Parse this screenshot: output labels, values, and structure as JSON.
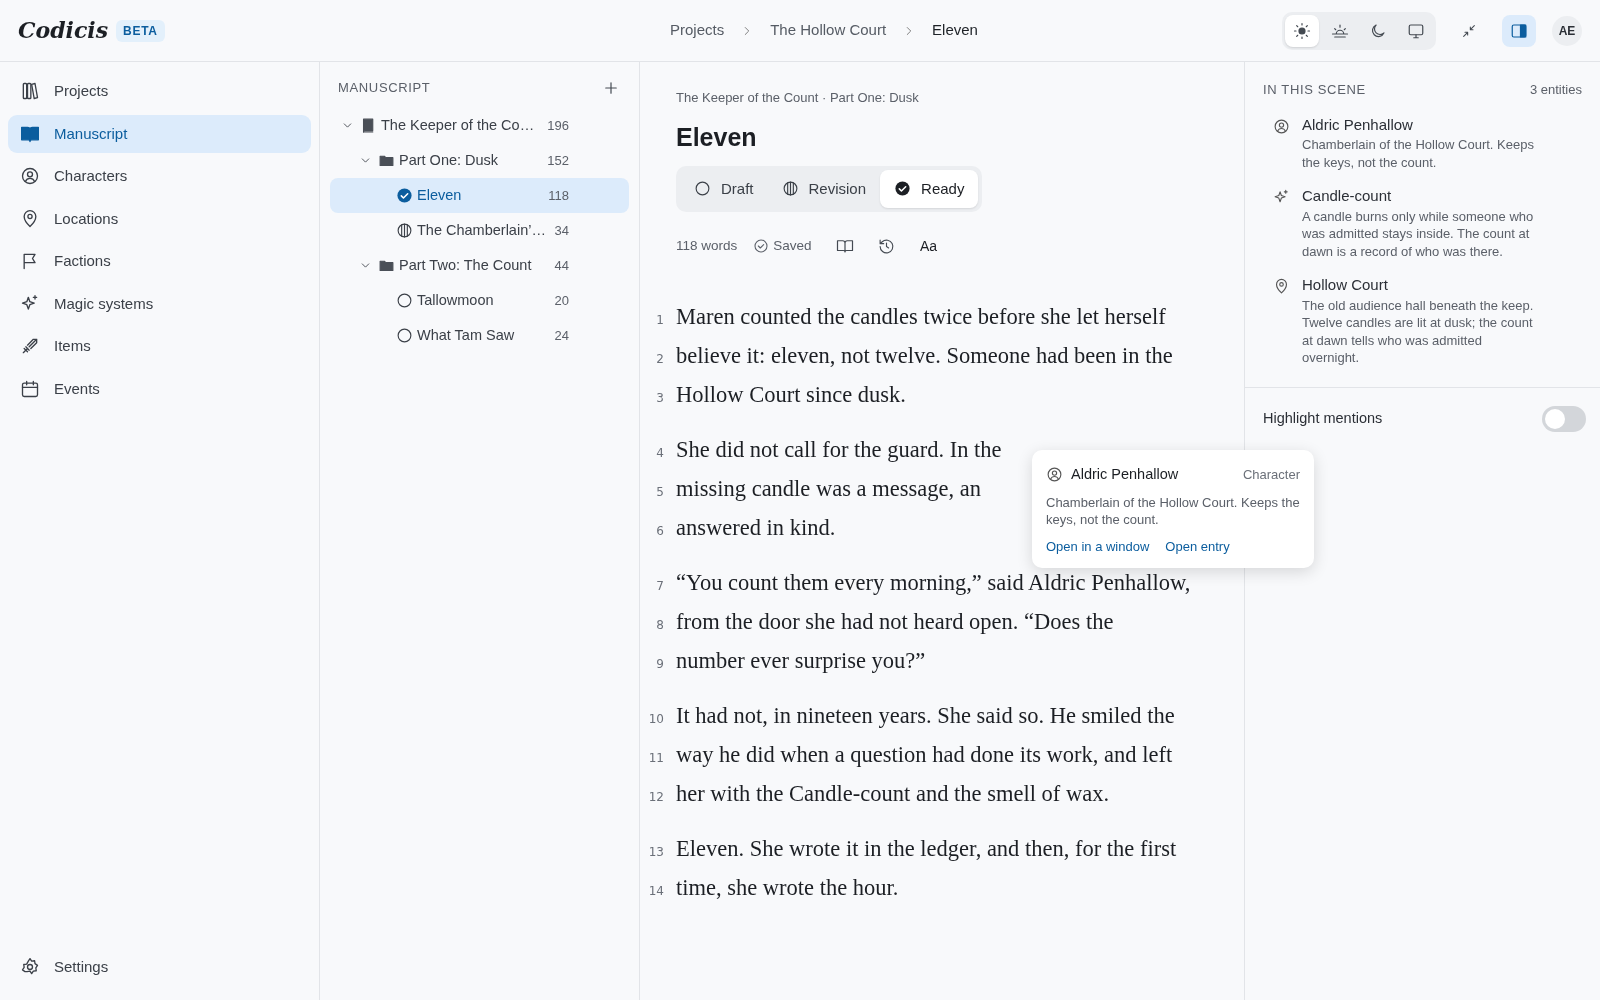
{
  "app": {
    "name": "Codicis",
    "badge": "BETA"
  },
  "breadcrumb": [
    "Projects",
    "The Hollow Court",
    "Eleven"
  ],
  "theme_options": [
    {
      "kind": "light",
      "selected": true
    },
    {
      "kind": "dawn",
      "selected": false
    },
    {
      "kind": "dark",
      "selected": false
    },
    {
      "kind": "system",
      "selected": false
    }
  ],
  "panel_toggle": {
    "on": true
  },
  "user_initials": "AE",
  "nav": {
    "items": [
      {
        "kind": "projects",
        "label": "Projects",
        "selected": false
      },
      {
        "kind": "manuscript",
        "label": "Manuscript",
        "selected": true
      },
      {
        "kind": "characters",
        "label": "Characters",
        "selected": false
      },
      {
        "kind": "locations",
        "label": "Locations",
        "selected": false
      },
      {
        "kind": "factions",
        "label": "Factions",
        "selected": false
      },
      {
        "kind": "magic",
        "label": "Magic systems",
        "selected": false
      },
      {
        "kind": "items",
        "label": "Items",
        "selected": false
      },
      {
        "kind": "events",
        "label": "Events",
        "selected": false
      }
    ],
    "settings": "Settings"
  },
  "manuscript": {
    "title": "MANUSCRIPT",
    "tree": [
      {
        "kind": "book",
        "label": "The Keeper of the Co…",
        "count": "196",
        "expanded": true,
        "selected": false,
        "children": [
          {
            "kind": "folder",
            "label": "Part One: Dusk",
            "count": "152",
            "expanded": true,
            "selected": false,
            "children": [
              {
                "kind": "ready",
                "label": "Eleven",
                "count": "118",
                "selected": true
              },
              {
                "kind": "revision",
                "label": "The Chamberlain’…",
                "count": "34",
                "selected": false
              }
            ]
          },
          {
            "kind": "folder",
            "label": "Part Two: The Count",
            "count": "44",
            "expanded": true,
            "selected": false,
            "children": [
              {
                "kind": "draft",
                "label": "Tallowmoon",
                "count": "20",
                "selected": false
              },
              {
                "kind": "draft",
                "label": "What Tam Saw",
                "count": "24",
                "selected": false
              }
            ]
          }
        ]
      }
    ]
  },
  "editor": {
    "context": "The Keeper of the Count · Part One: Dusk",
    "title": "Eleven",
    "status_options": [
      {
        "kind": "draft",
        "label": "Draft",
        "selected": false
      },
      {
        "kind": "revision",
        "label": "Revision",
        "selected": false
      },
      {
        "kind": "ready",
        "label": "Ready",
        "selected": true
      }
    ],
    "word_count": "118 words",
    "save_state": "Saved",
    "typography_button": "Aa",
    "paragraphs": [
      {
        "lines": [
          {
            "number": "1",
            "text": "Maren counted the candles twice before she let herself"
          },
          {
            "number": "2",
            "text": "believe it: eleven, not twelve. Someone had been in the"
          },
          {
            "number": "3",
            "text": "Hollow Court since dusk."
          }
        ]
      },
      {
        "lines": [
          {
            "number": "4",
            "text": "She did not call for the guard. In the"
          },
          {
            "number": "5",
            "text": "missing candle was a message, an"
          },
          {
            "number": "6",
            "text": "answered in kind."
          }
        ]
      },
      {
        "lines": [
          {
            "number": "7",
            "text": "“You count them every morning,” said Aldric Penhallow,"
          },
          {
            "number": "8",
            "text": "from the door she had not heard open. “Does the"
          },
          {
            "number": "9",
            "text": "number ever surprise you?”"
          }
        ]
      },
      {
        "lines": [
          {
            "number": "10",
            "text": "It had not, in nineteen years. She said so. He smiled the"
          },
          {
            "number": "11",
            "text": "way he did when a question had done its work, and left"
          },
          {
            "number": "12",
            "text": "her with the Candle-count and the smell of wax."
          }
        ]
      },
      {
        "lines": [
          {
            "number": "13",
            "text": "Eleven. She wrote it in the ledger, and then, for the first"
          },
          {
            "number": "14",
            "text": "time, she wrote the hour."
          }
        ]
      }
    ]
  },
  "popover": {
    "name": "Aldric Penhallow",
    "type": "Character",
    "description": "Chamberlain of the Hollow Court. Keeps the keys, not the count.",
    "links": [
      "Open in a window",
      "Open entry"
    ]
  },
  "scene_panel": {
    "title": "IN THIS SCENE",
    "count": "3 entities",
    "entities": [
      {
        "kind": "character",
        "name": "Aldric Penhallow",
        "description": "Chamberlain of the Hollow Court. Keeps the keys, not the count."
      },
      {
        "kind": "magic",
        "name": "Candle-count",
        "description": "A candle burns only while someone who was admitted stays inside. The count at dawn is a record of who was there."
      },
      {
        "kind": "location",
        "name": "Hollow Court",
        "description": "The old audience hall beneath the keep. Twelve candles are lit at dusk; the count at dawn tells who was admitted overnight."
      }
    ],
    "highlight_mentions": {
      "label": "Highlight mentions",
      "on": false
    }
  }
}
